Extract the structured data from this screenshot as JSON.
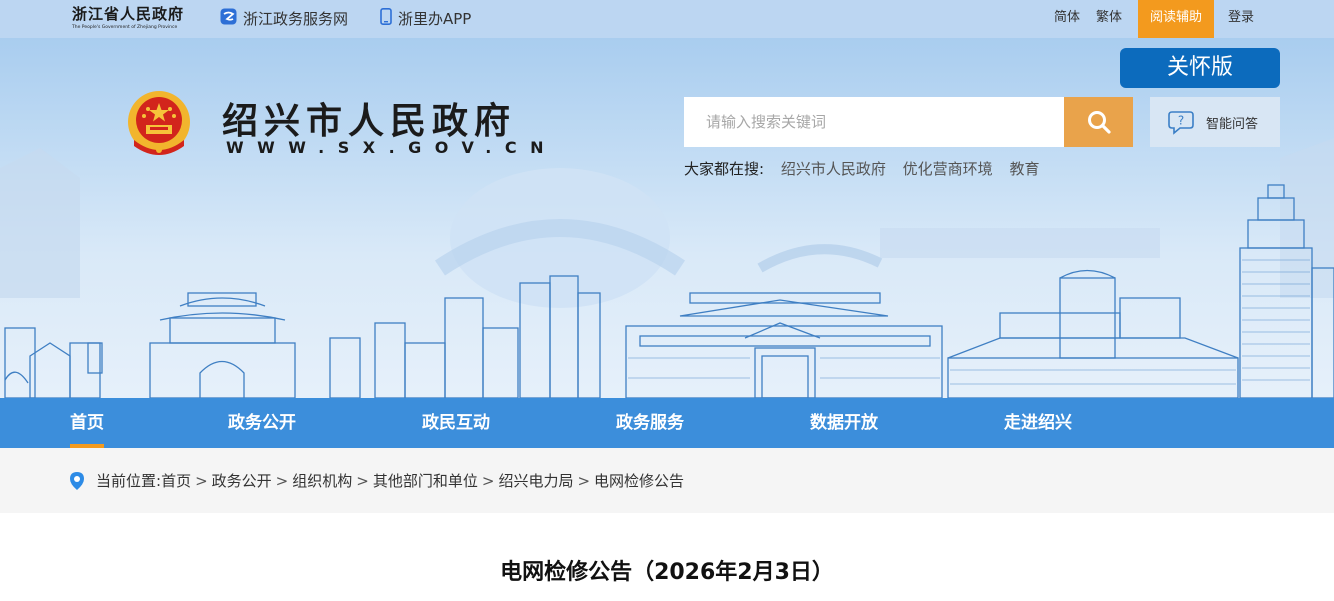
{
  "topbar": {
    "province_logo_cn": "浙江省人民政府",
    "province_logo_en": "The People's Government of Zhejiang Province",
    "links": [
      {
        "label": "浙江政务服务网",
        "icon": "zjzw-icon"
      },
      {
        "label": "浙里办APP",
        "icon": "phone-icon"
      }
    ],
    "simplified": "简体",
    "traditional": "繁体",
    "reading_aid": "阅读辅助",
    "login": "登录",
    "reading_aid_color": "#f39a1e"
  },
  "banner": {
    "site_name": "绍兴市人民政府",
    "site_url": "WWW.SX.GOV.CN",
    "care_button": "关怀版",
    "search_placeholder": "请输入搜索关键词",
    "smart_qa": "智能问答",
    "hot_label": "大家都在搜:",
    "hot_keywords": [
      "绍兴市人民政府",
      "优化营商环境",
      "教育"
    ]
  },
  "nav": {
    "items": [
      "首页",
      "政务公开",
      "政民互动",
      "政务服务",
      "数据开放",
      "走进绍兴"
    ],
    "active_index": 0,
    "bg_color": "#3c8edb"
  },
  "breadcrumb": {
    "label": "当前位置:",
    "items": [
      "首页",
      "政务公开",
      "组织机构",
      "其他部门和单位",
      "绍兴电力局",
      "电网检修公告"
    ]
  },
  "page_title": "电网检修公告（2026年2月3日）"
}
